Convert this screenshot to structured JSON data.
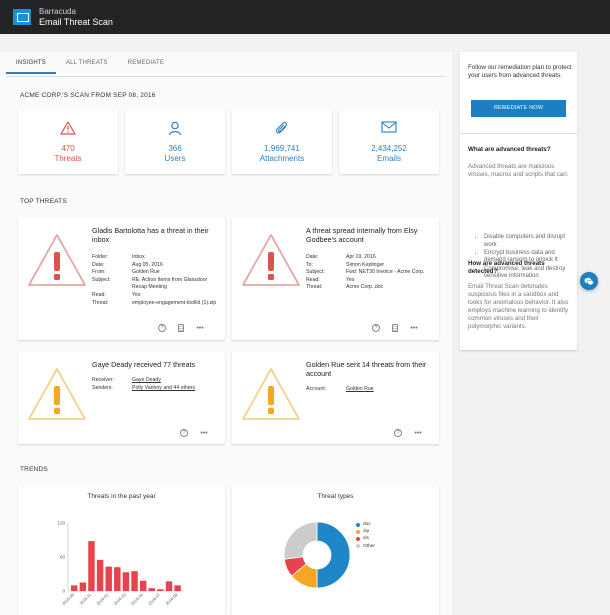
{
  "app": {
    "brand_line1": "Barracuda",
    "brand_line2": "Email Threat Scan"
  },
  "tabs": [
    {
      "label": "INSIGHTS",
      "active": true
    },
    {
      "label": "ALL THREATS",
      "active": false
    },
    {
      "label": "REMEDIATE",
      "active": false
    }
  ],
  "scan_title": "ACME CORP.'S SCAN FROM SEP 08, 2016",
  "stats": [
    {
      "icon": "warning-icon",
      "value": "470",
      "label": "Threats",
      "color": "#d9534f"
    },
    {
      "icon": "user-icon",
      "value": "366",
      "label": "Users",
      "color": "#2d7fc1"
    },
    {
      "icon": "paperclip-icon",
      "value": "1,969,741",
      "label": "Attachments",
      "color": "#2d7fc1"
    },
    {
      "icon": "envelope-icon",
      "value": "2,434,252",
      "label": "Emails",
      "color": "#2d7fc1"
    }
  ],
  "top_threats_title": "TOP THREATS",
  "threat_cards": [
    {
      "title": "Gladis Bartolotta has a threat in their inbox",
      "rows": [
        {
          "k": "Folder:",
          "v": "Inbox"
        },
        {
          "k": "Date:",
          "v": "Aug 05, 2016"
        },
        {
          "k": "From:",
          "v": "Golden Rue"
        },
        {
          "k": "Subject:",
          "v": "RE: Action Items from Glassdoor Recap Meeting"
        },
        {
          "k": "Read:",
          "v": "Yes"
        },
        {
          "k": "Threat:",
          "v": "employee-engagement-toolkit (1).zip"
        }
      ]
    },
    {
      "title": "A threat spread internally from Elsy Godbee's account",
      "rows": [
        {
          "k": "Date:",
          "v": "Apr 19, 2016"
        },
        {
          "k": "To:",
          "v": "Simon Keplinger"
        },
        {
          "k": "Subject:",
          "v": "Fwd: NET30 Invoice - Acme Corp."
        },
        {
          "k": "Read:",
          "v": "Yes"
        },
        {
          "k": "Threat:",
          "v": "Acme Corp..doc"
        }
      ]
    },
    {
      "title": "Gaye Deady received 77 threats",
      "rows": [
        {
          "k": "Receiver:",
          "v": "Gaye Deady"
        },
        {
          "k": "Senders:",
          "v": "Polly Vanhoy and 44 others"
        }
      ]
    },
    {
      "title": "Golden Rue sent 14 threats from their account",
      "rows": [
        {
          "k": "Account:",
          "v": "Golden Rue"
        }
      ]
    }
  ],
  "trends_title": "TRENDS",
  "chart_data": [
    {
      "type": "bar",
      "title": "Threats in the past year",
      "categories": [
        "2015-09",
        "2015-10",
        "2015-11",
        "2015-12",
        "2016-01",
        "2016-02",
        "2016-03",
        "2016-04",
        "2016-05",
        "2016-06",
        "2016-07",
        "2016-08",
        "2016-09"
      ],
      "tick_labels": [
        "2015-09",
        "2015-11",
        "2016-01",
        "2016-03",
        "2016-05",
        "2016-07",
        "2016-09"
      ],
      "values": [
        10,
        15,
        88,
        55,
        43,
        42,
        33,
        35,
        18,
        5,
        3,
        17,
        10
      ],
      "ylim": [
        0,
        120
      ],
      "yticks": [
        0,
        60,
        120
      ],
      "color": "#e8434c"
    },
    {
      "type": "pie",
      "title": "Threat types",
      "donut": true,
      "labels": [
        "doc",
        "zip",
        "xls",
        "Other"
      ],
      "values": [
        50,
        14,
        9,
        27
      ],
      "colors": [
        "#1f86c7",
        "#f5a623",
        "#e8434c",
        "#cccccc"
      ]
    }
  ],
  "sidebar": {
    "intro": "Follow our remediation plan to protect your users from advanced threats.",
    "button": "REMEDIATE NOW",
    "q1": "What are advanced threats?",
    "a1": "Advanced threats are malicious viruses, macros and scripts that can:",
    "bullets": [
      "Disable computers and disrupt work",
      "Encrypt business data and demand ransom to unlock it",
      "Compromise, leak and destroy sensitive information"
    ],
    "q2": "How are advanced threats detected?",
    "a2": "Email Threat Scan detonates suspicious files in a sandbox and looks for anomalous behavior. It also employs machine learning to identify common viruses and their polymorphic variants."
  }
}
